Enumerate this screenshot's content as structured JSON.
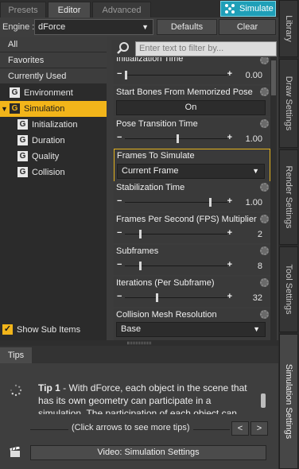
{
  "tabs": [
    {
      "label": "Presets"
    },
    {
      "label": "Editor"
    },
    {
      "label": "Advanced"
    }
  ],
  "simulate_label": "Simulate",
  "engine": {
    "label": "Engine :",
    "value": "dForce",
    "defaults_label": "Defaults",
    "clear_label": "Clear"
  },
  "tree": {
    "all": "All",
    "favorites": "Favorites",
    "currently_used": "Currently Used",
    "environment": "Environment",
    "simulation": "Simulation",
    "initialization": "Initialization",
    "duration": "Duration",
    "quality": "Quality",
    "collision": "Collision",
    "group_icon_letter": "G",
    "show_sub_items": "Show Sub Items"
  },
  "filter_placeholder": "Enter text to filter by...",
  "properties": {
    "initialization_time": {
      "label": "Initialization Time",
      "value": "0.00",
      "fill": 0.0
    },
    "start_bones": {
      "label": "Start Bones From Memorized Pose",
      "value": "On"
    },
    "pose_transition": {
      "label": "Pose Transition Time",
      "value": "1.00",
      "fill": 0.5
    },
    "frames_to_simulate": {
      "label": "Frames To Simulate",
      "value": "Current Frame"
    },
    "stabilization": {
      "label": "Stabilization Time",
      "value": "1.00",
      "fill": 0.82
    },
    "fps_multiplier": {
      "label": "Frames Per Second (FPS) Multiplier",
      "value": "2",
      "fill": 0.14
    },
    "subframes": {
      "label": "Subframes",
      "value": "8",
      "fill": 0.14
    },
    "iterations": {
      "label": "Iterations (Per Subframe)",
      "value": "32",
      "fill": 0.3
    },
    "collision_mesh": {
      "label": "Collision Mesh Resolution",
      "value": "Base"
    }
  },
  "vertical_tabs": [
    {
      "label": "Library"
    },
    {
      "label": "Draw Settings"
    },
    {
      "label": "Render Settings"
    },
    {
      "label": "Tool Settings"
    },
    {
      "label": "Simulation Settings"
    }
  ],
  "tips": {
    "tab_label": "Tips",
    "tip_title": "Tip 1",
    "tip_body": " - With dForce, each object in the scene that has its own geometry can participate in a simulation. The participation of each object can",
    "hint": "(Click arrows to see more tips)",
    "prev": "<",
    "next": ">",
    "video_label": "Video: Simulation Settings"
  },
  "colors": {
    "accent": "#f2b51a",
    "simulate": "#1f9fb8"
  }
}
